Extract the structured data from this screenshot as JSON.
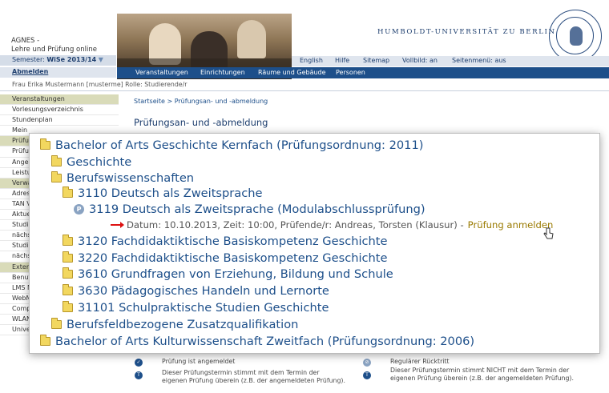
{
  "brand": {
    "name": "AGNES -",
    "subtitle": "Lehre und Prüfung online"
  },
  "university": "HUMBOLDT-UNIVERSITÄT ZU BERLIN",
  "semester": {
    "label": "Semester:",
    "value": "WiSe 2013/14"
  },
  "logout": "Abmelden",
  "topbar": {
    "english": "English",
    "help": "Hilfe",
    "sitemap": "Sitemap",
    "fullscreen": "Vollbild: an",
    "side_menu": "Seitenmenü: aus"
  },
  "nav": [
    "Veranstaltungen",
    "Einrichtungen",
    "Räume und Gebäude",
    "Personen"
  ],
  "user": {
    "name": "Frau Erika Mustermann",
    "login": "[musterme]",
    "role_label": "Rolle:",
    "role": "Studierende/r"
  },
  "sidebar": {
    "items": [
      {
        "label": "Veranstaltungen"
      },
      {
        "label": "Vorlesungsverzeichnis"
      },
      {
        "label": "Stundenplan"
      },
      {
        "label": "Mein"
      },
      {
        "label": "Prüfu"
      },
      {
        "label": "Prüfu"
      },
      {
        "label": "Anger"
      },
      {
        "label": "Leistu"
      },
      {
        "label": "Verwa"
      },
      {
        "label": "Adres"
      },
      {
        "label": "TAN V"
      },
      {
        "label": "Aktue"
      },
      {
        "label": "Studie"
      },
      {
        "label": "nächs"
      },
      {
        "label": "Studie"
      },
      {
        "label": "nächs"
      },
      {
        "label": "Exter"
      },
      {
        "label": "Benut"
      },
      {
        "label": "LMS M"
      },
      {
        "label": "WebM"
      },
      {
        "label": "Compass-Hotline"
      },
      {
        "label": "WLAN-Zugang"
      },
      {
        "label": "Universitätsbibliothek"
      }
    ]
  },
  "breadcrumb": "Startseite > Prüfungsan- und -abmeldung",
  "page_title": "Prüfungsan- und -abmeldung",
  "tree": {
    "n1": "Bachelor of Arts Geschichte Kernfach (Prüfungsordnung: 2011)",
    "n2": "Geschichte",
    "n3": "Berufswissenschaften",
    "n4": "3110 Deutsch als Zweitsprache",
    "n5": "3119 Deutsch als Zweitsprache (Modulabschlussprüfung)",
    "detail": "Datum: 10.10.2013, Zeit: 10:00, Prüfende/r: Andreas, Torsten (Klausur) -",
    "register_link": "Prüfung anmelden",
    "n6": "3120 Fachdidaktiktische Basiskompetenz Geschichte",
    "n7": "3220 Fachdidaktiktische Basiskompetenz Geschichte",
    "n8": "3610 Grundfragen von Erziehung, Bildung und Schule",
    "n9": "3630 Pädagogisches Handeln und Lernorte",
    "n10": "31101 Schulpraktische Studien Geschichte",
    "n11": "Berufsfeldbezogene Zusatzqualifikation",
    "n12": "Bachelor of Arts Kulturwissenschaft Zweitfach (Prüfungsordnung: 2006)"
  },
  "legend": {
    "l1": "Prüfung ist angemeldet",
    "l2": "Dieser Prüfungstermin stimmt mit dem Termin der eigenen Prüfung überein (z.B. der angemeldeten Prüfung).",
    "l3": "Regulärer Rücktritt",
    "l4": "Dieser Prüfungstermin stimmt NICHT mit dem Termin der eigenen Prüfung überein (z.B. der angemeldeten Prüfung)."
  },
  "colors": {
    "link": "#1d4f8a",
    "nav_bg": "#1d4f8a",
    "register": "#9a7a00",
    "arrow": "#dd1111"
  }
}
